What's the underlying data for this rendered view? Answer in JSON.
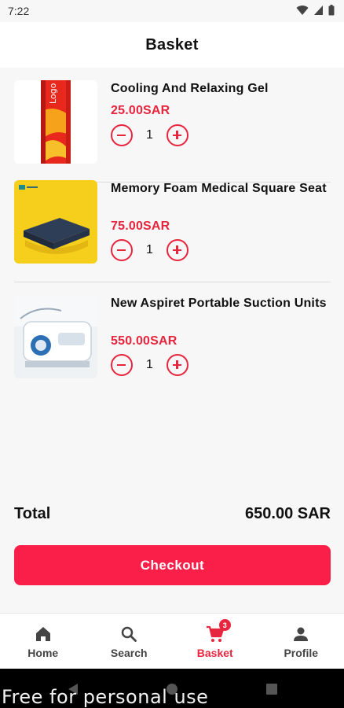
{
  "status_bar": {
    "time": "7:22"
  },
  "header": {
    "title": "Basket"
  },
  "basket": {
    "items": [
      {
        "name": "Cooling And Relaxing Gel",
        "price": "25.00SAR",
        "quantity": "1"
      },
      {
        "name": "Memory Foam Medical Square Seat",
        "price": "75.00SAR",
        "quantity": "1"
      },
      {
        "name": "New Aspiret Portable Suction Units",
        "price": "550.00SAR",
        "quantity": "1"
      }
    ],
    "total_label": "Total",
    "total_value": "650.00 SAR",
    "checkout_label": "Checkout"
  },
  "bottom_nav": {
    "items": [
      {
        "label": "Home",
        "icon": "home-icon"
      },
      {
        "label": "Search",
        "icon": "search-icon"
      },
      {
        "label": "Basket",
        "icon": "cart-icon",
        "badge": "3",
        "active": true
      },
      {
        "label": "Profile",
        "icon": "person-icon"
      }
    ]
  },
  "watermark": "Free for personal use",
  "colors": {
    "accent": "#e8253e",
    "checkout": "#fa1f48",
    "background": "#f7f7f7"
  }
}
